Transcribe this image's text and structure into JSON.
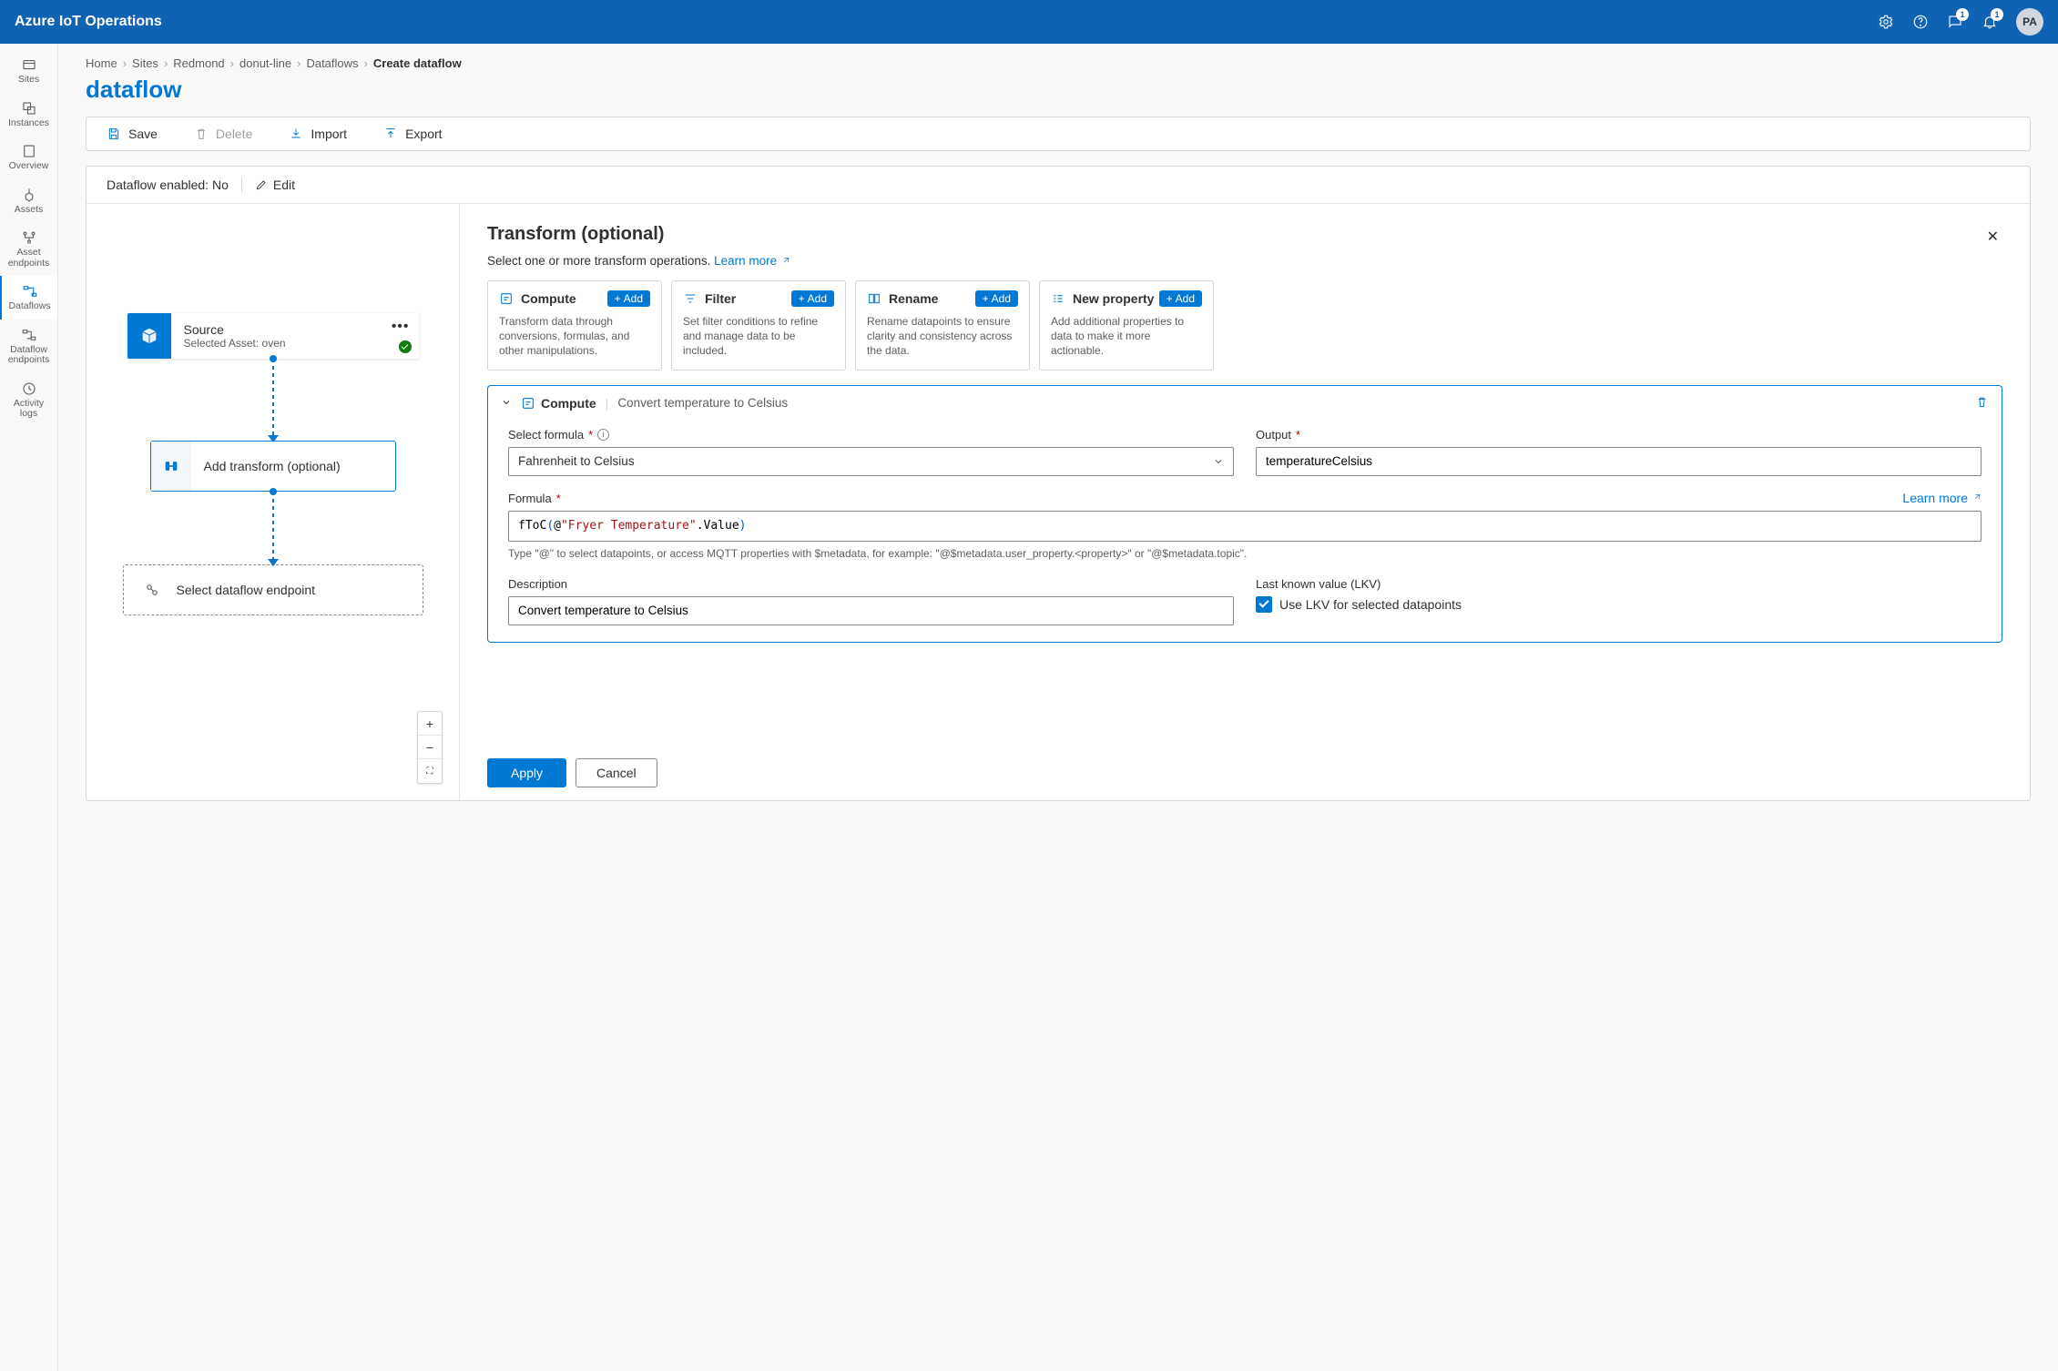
{
  "header": {
    "title": "Azure IoT Operations",
    "notification_badge": "1",
    "bell_badge": "1",
    "avatar_initials": "PA"
  },
  "sidenav": {
    "items": [
      {
        "label": "Sites"
      },
      {
        "label": "Instances"
      },
      {
        "label": "Overview"
      },
      {
        "label": "Assets"
      },
      {
        "label": "Asset\nendpoints"
      },
      {
        "label": "Dataflows"
      },
      {
        "label": "Dataflow\nendpoints"
      },
      {
        "label": "Activity\nlogs"
      }
    ]
  },
  "breadcrumb": {
    "items": [
      "Home",
      "Sites",
      "Redmond",
      "donut-line",
      "Dataflows"
    ],
    "current": "Create dataflow"
  },
  "page_title": "dataflow",
  "toolbar": {
    "save": "Save",
    "delete": "Delete",
    "import": "Import",
    "export": "Export"
  },
  "enabled_bar": {
    "label": "Dataflow enabled: No",
    "edit": "Edit"
  },
  "flow": {
    "source": {
      "title": "Source",
      "sub": "Selected Asset: oven"
    },
    "transform": {
      "label": "Add transform (optional)"
    },
    "endpoint": {
      "label": "Select dataflow endpoint"
    }
  },
  "panel": {
    "title": "Transform (optional)",
    "subtitle": "Select one or more transform operations.",
    "learn_more": "Learn more",
    "ops": [
      {
        "name": "Compute",
        "desc": "Transform data through conversions, formulas, and other manipulations."
      },
      {
        "name": "Filter",
        "desc": "Set filter conditions to refine and manage data to be included."
      },
      {
        "name": "Rename",
        "desc": "Rename datapoints to ensure clarity and consistency across the data."
      },
      {
        "name": "New property",
        "desc": "Add additional properties to data to make it more actionable."
      }
    ],
    "add": "Add",
    "step": {
      "kind": "Compute",
      "name": "Convert temperature to Celsius",
      "formula_label": "Select formula",
      "formula_value": "Fahrenheit to Celsius",
      "output_label": "Output",
      "output_value": "temperatureCelsius",
      "formula_field_label": "Formula",
      "formula_fn": "fToC",
      "formula_at": "@",
      "formula_str": "\"Fryer Temperature\"",
      "formula_prop": ".Value",
      "hint": "Type \"@\" to select datapoints, or access MQTT properties with $metadata, for example: \"@$metadata.user_property.<property>\" or \"@$metadata.topic\".",
      "description_label": "Description",
      "description_value": "Convert temperature to Celsius",
      "lkv_label": "Last known value (LKV)",
      "lkv_check_label": "Use LKV for selected datapoints"
    },
    "apply": "Apply",
    "cancel": "Cancel"
  }
}
